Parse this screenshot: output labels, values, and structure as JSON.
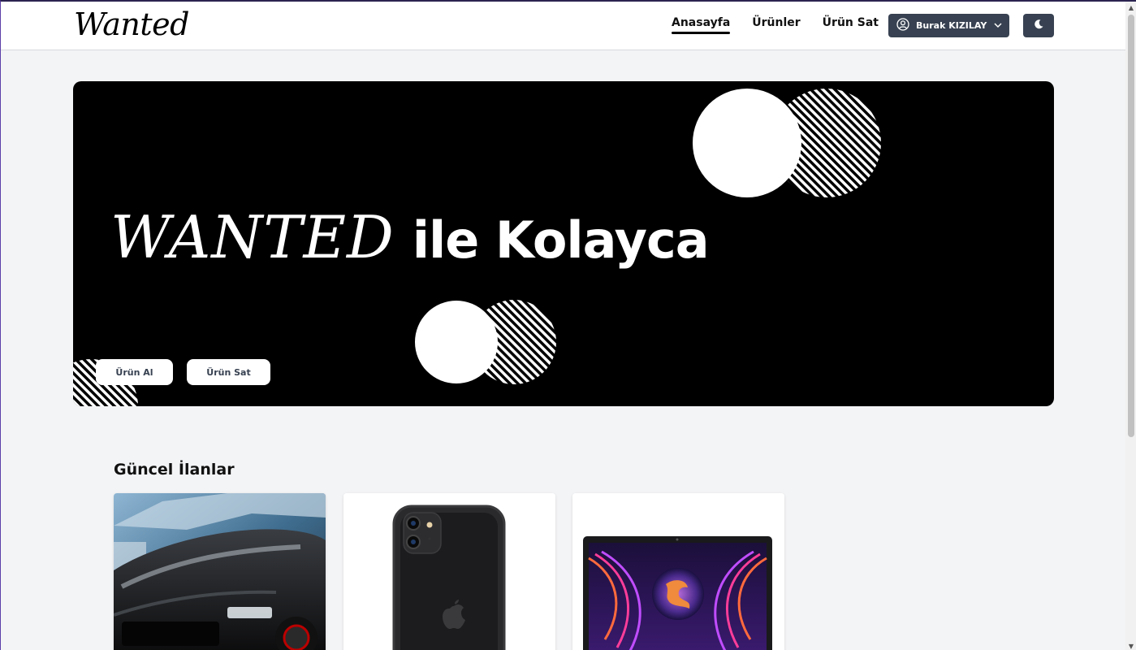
{
  "header": {
    "logo": "Wanted",
    "nav": [
      {
        "label": "Anasayfa",
        "active": true
      },
      {
        "label": "Ürünler",
        "active": false
      },
      {
        "label": "Ürün Sat",
        "active": false
      }
    ],
    "user_name": "Burak KIZILAY",
    "user_icon": "user-circle-icon",
    "dropdown_icon": "chevron-down-icon",
    "theme_icon": "moon-icon"
  },
  "hero": {
    "brand": "WANTED",
    "tagline": "ile Kolayca",
    "buttons": {
      "buy": "Ürün Al",
      "sell": "Ürün Sat"
    }
  },
  "listings": {
    "title": "Güncel İlanlar",
    "items": [
      {
        "image": "black-sports-car-image"
      },
      {
        "image": "black-smartphone-image"
      },
      {
        "image": "gaming-laptop-image"
      }
    ]
  },
  "colors": {
    "accent_dark": "#374151",
    "hero_bg": "#000000",
    "page_bg": "#f3f4f6"
  }
}
